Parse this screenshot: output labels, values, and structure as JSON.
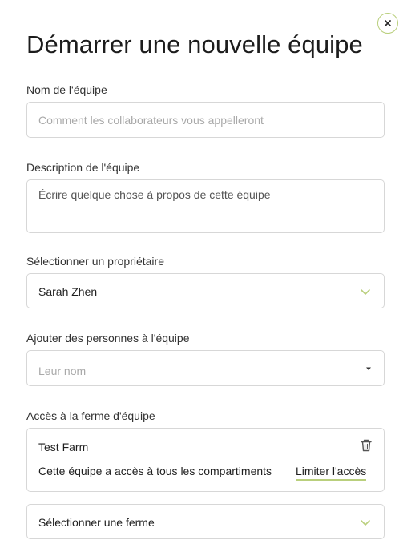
{
  "dialog": {
    "title": "Démarrer une nouvelle équipe",
    "close_icon": "close-icon"
  },
  "team_name": {
    "label": "Nom de l'équipe",
    "placeholder": "Comment les collaborateurs vous appelleront"
  },
  "team_description": {
    "label": "Description de l'équipe",
    "placeholder": "Écrire quelque chose à propos de cette équipe"
  },
  "owner": {
    "label": "Sélectionner un propriétaire",
    "selected": "Sarah Zhen",
    "icon": "chevron-down-icon"
  },
  "add_people": {
    "label": "Ajouter des personnes à l'équipe",
    "placeholder": "Leur nom",
    "icon": "caret-down-icon"
  },
  "farm_access": {
    "label": "Accès à la ferme d'équipe",
    "farm_name": "Test Farm",
    "access_text": "Cette équipe a accès à tous les compartiments",
    "limit_link": "Limiter l'accès",
    "delete_icon": "trash-icon"
  },
  "select_farm": {
    "selected": "Sélectionner une ferme",
    "icon": "chevron-down-icon"
  },
  "colors": {
    "accent": "#b9cf7c",
    "border": "#d7d7d7",
    "placeholder": "#a9a9a9",
    "text": "#1f1f1f"
  }
}
